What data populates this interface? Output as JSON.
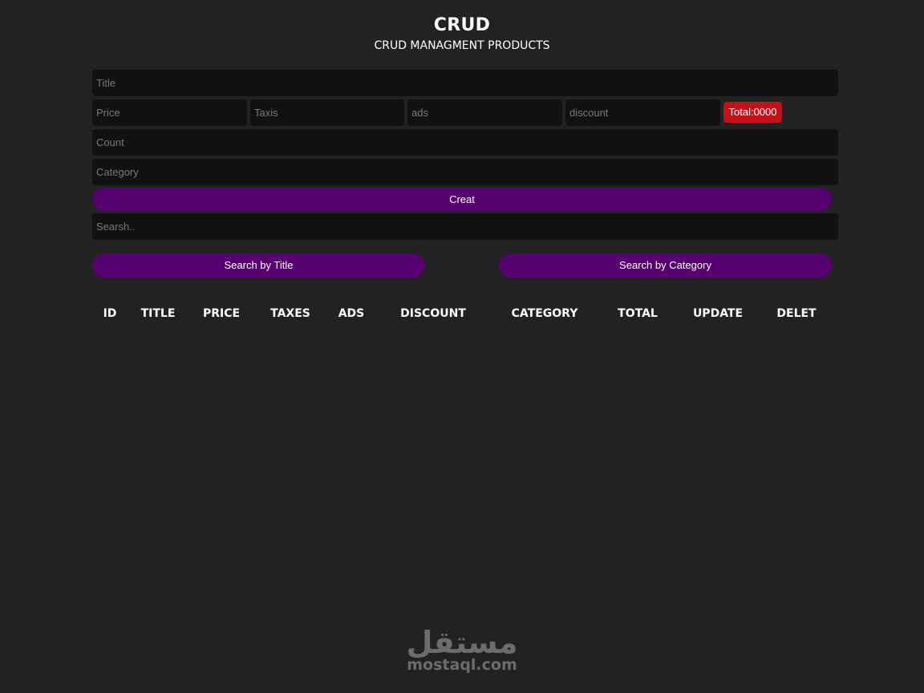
{
  "header": {
    "title": "CRUD",
    "subtitle": "CRUD MANAGMENT PRODUCTS"
  },
  "form": {
    "title_placeholder": "Title",
    "price_placeholder": "Price",
    "taxes_placeholder": "Taxis",
    "ads_placeholder": "ads",
    "discount_placeholder": "discount",
    "total_label": "Total:0000",
    "count_placeholder": "Count",
    "category_placeholder": "Category",
    "create_label": "Creat"
  },
  "search": {
    "placeholder": "Searsh..",
    "by_title_label": "Search by Title",
    "by_category_label": "Search by Category"
  },
  "table": {
    "headers": [
      "ID",
      "TITLE",
      "PRICE",
      "TAXES",
      "ADS",
      "DISCOUNT",
      "CATEGORY",
      "TOTAL",
      "UPDATE",
      "DELET"
    ],
    "rows": []
  },
  "watermark": {
    "arabic": "مستقل",
    "latin": "mostaql.com"
  },
  "colors": {
    "background": "#222222",
    "input_background": "#111111",
    "button": "#570070",
    "total_badge": "#c4121a"
  }
}
